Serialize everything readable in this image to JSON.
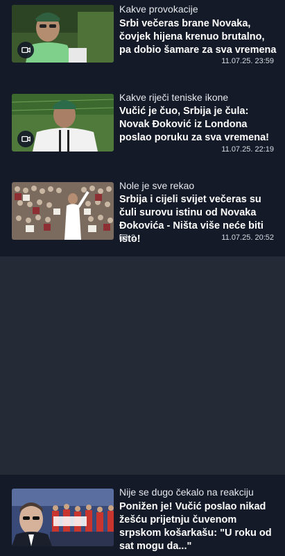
{
  "articles": [
    {
      "kicker": "Kakve provokacije",
      "headline": "Srbi večeras brane Novaka, čovjek hijena krenuo brutalno, pa dobio šamare za sva vremena",
      "time": "11.07.25. 23:59",
      "comments": "",
      "has_video": true
    },
    {
      "kicker": "Kakve riječi teniske ikone",
      "headline": "Vučić je čuo, Srbija je čula: Novak Đoković iz Londona poslao poruku za sva vremena!",
      "time": "11.07.25. 22:19",
      "comments": "",
      "has_video": true
    },
    {
      "kicker": "Nole je sve rekao",
      "headline": "Srbija i cijeli svijet večeras su čuli surovu istinu od Novaka Đokovića - Ništa više neće biti isto!",
      "time": "11.07.25. 20:52",
      "comments": "2",
      "has_video": false
    },
    {
      "kicker": "Nije se dugo čekalo na reakciju",
      "headline": "Ponižen je! Vučić poslao nikad žešću prijetnju čuvenom srpskom košarkašu: \"U roku od sat mogu da...\"",
      "time": "",
      "comments": "",
      "has_video": false
    }
  ],
  "colors": {
    "background": "#141a27",
    "gap": "#242a36",
    "text": "#ffffff",
    "meta": "#d9dce4"
  }
}
